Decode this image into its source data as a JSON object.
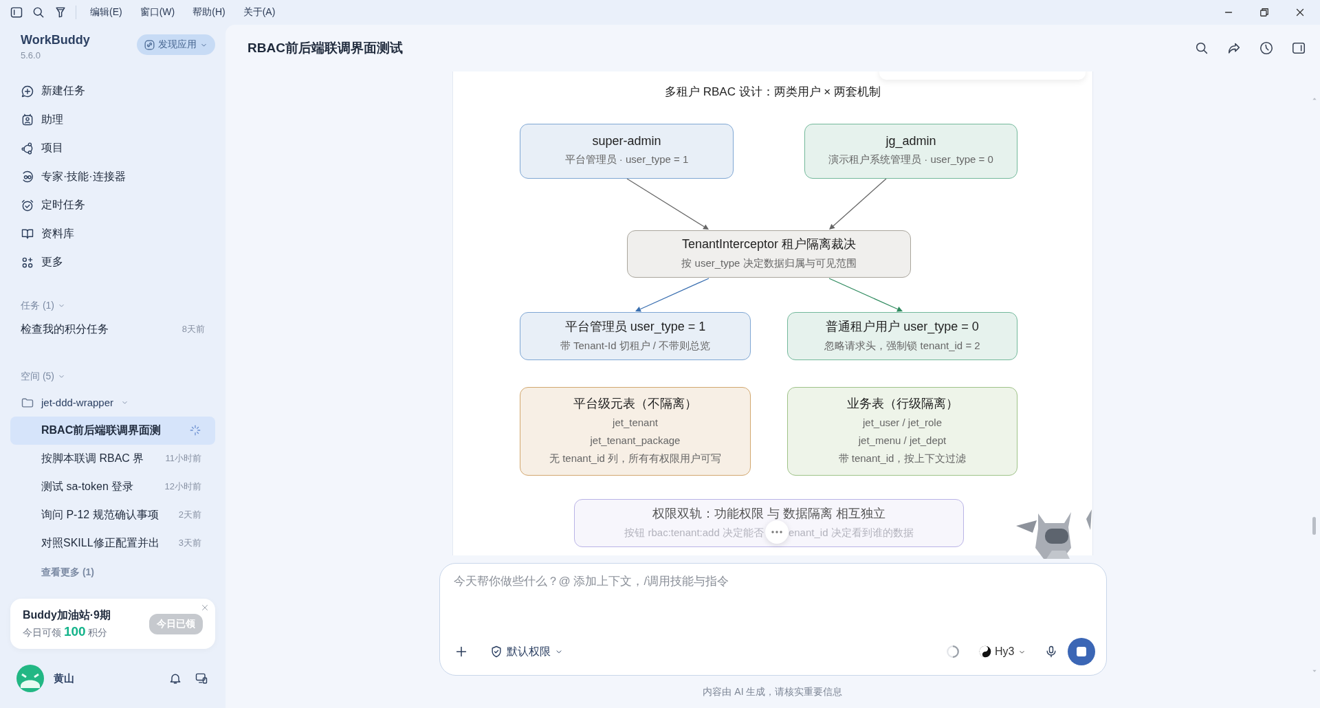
{
  "menu_bar": {
    "menus": [
      "编辑(E)",
      "窗口(W)",
      "帮助(H)",
      "关于(A)"
    ]
  },
  "sidebar": {
    "app_name": "WorkBuddy",
    "version": "5.6.0",
    "discover_button": "发现应用",
    "nav_items": [
      {
        "label": "新建任务"
      },
      {
        "label": "助理"
      },
      {
        "label": "项目"
      },
      {
        "label": "专家·技能·连接器"
      },
      {
        "label": "定时任务"
      },
      {
        "label": "资料库"
      },
      {
        "label": "更多"
      }
    ],
    "tasks_section": {
      "title": "任务 (1)",
      "items": [
        {
          "title": "检查我的积分任务",
          "time": "8天前"
        }
      ]
    },
    "spaces_section": {
      "title": "空间 (5)",
      "folder": "jet-ddd-wrapper",
      "items": [
        {
          "title": "RBAC前后端联调界面测",
          "selected": true,
          "running": true
        },
        {
          "title": "按脚本联调 RBAC 界",
          "time": "11小时前",
          "selected": false,
          "running": false
        },
        {
          "title": "测试 sa-token 登录",
          "time": "12小时前",
          "selected": false,
          "running": false
        },
        {
          "title": "询问 P-12 规范确认事项",
          "time": "2天前",
          "selected": false,
          "running": false
        },
        {
          "title": "对照SKILL修正配置并出",
          "time": "3天前",
          "selected": false,
          "running": false
        }
      ],
      "more_link": "查看更多 (1)"
    },
    "promo": {
      "title": "Buddy加油站·9期",
      "text": "今日可领 **100** 积分",
      "button": "今日已领"
    },
    "user": {
      "name": "黄山"
    }
  },
  "header": {
    "title": "RBAC前后端联调界面测试"
  },
  "diagram": {
    "title": "多租户 RBAC 设计：两类用户 × 两套机制",
    "nodes": [
      {
        "kind": "box",
        "title": "super-admin",
        "lines": [
          "平台管理员 · user_type = 1"
        ],
        "color": "#7ea6d3"
      },
      {
        "kind": "box",
        "title": "jg_admin",
        "lines": [
          "演示租户系统管理员 · user_type = 0"
        ],
        "color": "#72b89a"
      },
      {
        "kind": "box",
        "title": "TenantInterceptor 租户隔离裁决",
        "lines": [
          "按 user_type 决定数据归属与可见范围"
        ],
        "color": "#a9a59c"
      },
      {
        "kind": "box",
        "title": "平台管理员 user_type = 1",
        "lines": [
          "带 Tenant-Id 切租户 / 不带则总览"
        ],
        "color": "#7ea6d3"
      },
      {
        "kind": "box",
        "title": "普通租户用户 user_type = 0",
        "lines": [
          "忽略请求头，强制锁 tenant_id = 2"
        ],
        "color": "#72b89a"
      },
      {
        "kind": "box",
        "title": "平台级元表（不隔离）",
        "lines": [
          "jet_tenant",
          "jet_tenant_package",
          "无 tenant_id 列，所有有权限用户可写"
        ],
        "color": "#d2a76e"
      },
      {
        "kind": "box",
        "title": "业务表（行级隔离）",
        "lines": [
          "jet_user / jet_role",
          "jet_menu / jet_dept",
          "带 tenant_id，按上下文过滤"
        ],
        "color": "#9ec287"
      },
      {
        "kind": "note",
        "title": "权限双轨：功能权限 与 数据隔离 相互独立",
        "lines": [
          "按钮 rbac:tenant:add 决定能否",
          "enant_id 决定看到谁的数据"
        ],
        "color": "#b9b3e6"
      }
    ],
    "edges": [
      {
        "color": "#666666"
      },
      {
        "color": "#666666"
      },
      {
        "color": "#3a6fb0"
      },
      {
        "color": "#2e8a5e"
      }
    ]
  },
  "composer": {
    "placeholder": "今天帮你做些什么？@ 添加上下文，/调用技能与指令",
    "permission": "默认权限",
    "model": "Hy3"
  },
  "footer": {
    "text": "内容由 AI 生成，请核实重要信息"
  }
}
